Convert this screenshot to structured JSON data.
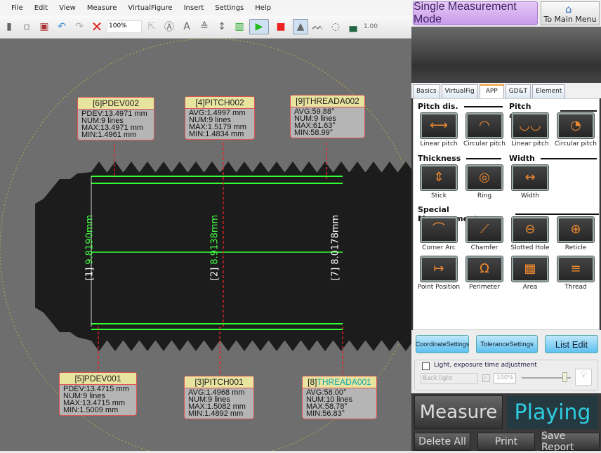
{
  "menu": [
    "File",
    "Edit",
    "View",
    "Measure",
    "VirtualFigure",
    "Insert",
    "Settings",
    "Help"
  ],
  "toolbar": {
    "zoom": "100%",
    "icons": [
      "camera-icon",
      "save-icon",
      "image-export-icon",
      "undo-icon",
      "redo-icon",
      "delete-icon",
      "zoom-select",
      "pointer-icon",
      "auto-detect-icon",
      "text-icon",
      "edge-icon",
      "height-icon",
      "bars-icon",
      "play-icon",
      "stop-icon",
      "tree-focus-icon",
      "multi-focus-icon",
      "circle-select-icon",
      "fill-icon",
      "scale-icon"
    ],
    "scale": "1.00"
  },
  "view": {
    "dims": [
      {
        "label": "[1] 9.8190mm",
        "id": "[1]",
        "val": "9.8190mm"
      },
      {
        "id": "[2]",
        "val": "8.9138mm"
      },
      {
        "id": "[7]",
        "val": "8.0178mm"
      }
    ],
    "boxes": [
      {
        "title": "[6]PDEV002",
        "lines": [
          "PDEV:13.4971 mm",
          "NUM:9 lines",
          "MAX:13.4971 mm",
          "MIN:1.4961 mm"
        ]
      },
      {
        "title": "[4]PITCH002",
        "lines": [
          "AVG:1.4997 mm",
          "NUM:9 lines",
          "MAX:1.5179 mm",
          "MIN:1.4834 mm"
        ]
      },
      {
        "title": "[9]THREADA002",
        "lines": [
          "AVG:59.88°",
          "NUM:9 lines",
          "MAX:61.63°",
          "MIN:58.99°"
        ]
      },
      {
        "title": "[5]PDEV001",
        "lines": [
          "PDEV:13.4715 mm",
          "NUM:9 lines",
          "MAX:13.4715 mm",
          "MIN:1.5009 mm"
        ]
      },
      {
        "title": "[3]PITCH001",
        "lines": [
          "AVG:1.4968 mm",
          "NUM:9 lines",
          "MAX:1.5082 mm",
          "MIN:1.4892 mm"
        ]
      },
      {
        "title_prefix": "[8]",
        "title_name": "THREADA001",
        "lines": [
          "AVG:58.00°",
          "NUM:10 lines",
          "MAX:58.78°",
          "MIN:56.83°"
        ]
      }
    ]
  },
  "right": {
    "mode": "Single Measurement Mode",
    "main_menu": "To Main Menu",
    "tabs": [
      "Basics",
      "VirtualFig",
      "APP",
      "GD&T",
      "Element"
    ],
    "selected_tab": "APP",
    "sections": {
      "pitch_dis": "Pitch dis.",
      "pitch_angle": "Pitch angle",
      "thickness": "Thickness",
      "width": "Width",
      "special": "Special Measurement"
    },
    "tools": [
      "Linear pitch",
      "Circular pitch",
      "Linear pitch",
      "Circular pitch",
      "Stick",
      "Ring",
      "Width",
      "Corner Arc",
      "Chamfer",
      "Slotted Hole",
      "Reticle",
      "Point Position",
      "Perimeter",
      "Area",
      "Thread"
    ],
    "buttons": {
      "coord": "CoordinateSettings",
      "tol": "ToleranceSettings",
      "list": "List Edit"
    },
    "light": {
      "label": "Light, exposure time adjustment",
      "checked": false,
      "source": "Back light",
      "percent": "100%",
      "level": 0.9
    },
    "measure": "Measure",
    "status": "Playing",
    "delete_all": "Delete All",
    "print": "Print",
    "save_report": "Save Report",
    "accent": "#2ecde0"
  }
}
